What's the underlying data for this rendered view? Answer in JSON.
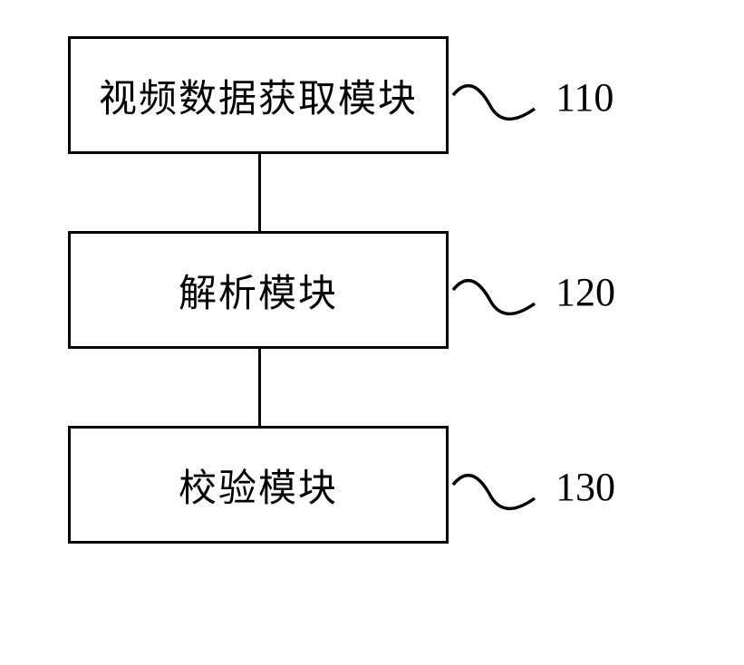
{
  "blocks": [
    {
      "text": "视频数据获取模块",
      "ref": "110"
    },
    {
      "text": "解析模块",
      "ref": "120"
    },
    {
      "text": "校验模块",
      "ref": "130"
    }
  ]
}
